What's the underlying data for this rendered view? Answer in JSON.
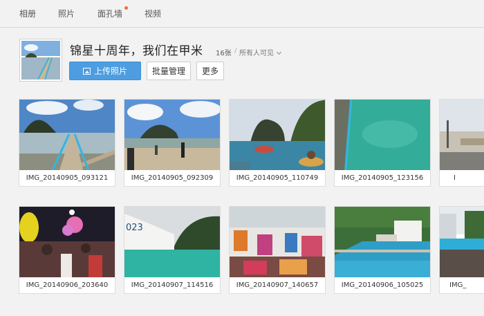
{
  "tabs": [
    {
      "label": "相册"
    },
    {
      "label": "照片"
    },
    {
      "label": "面孔墙",
      "has_dot": true
    },
    {
      "label": "视频"
    }
  ],
  "album": {
    "title": "锦星十周年，我们在甲米",
    "count": "16张",
    "separator": "/",
    "visibility": "所有人可见"
  },
  "buttons": {
    "upload": "上传照片",
    "manage": "批量管理",
    "more": "更多"
  },
  "photos_row1": [
    {
      "name": "IMG_20140905_093121"
    },
    {
      "name": "IMG_20140905_092309"
    },
    {
      "name": "IMG_20140905_110749"
    },
    {
      "name": "IMG_20140905_123156"
    },
    {
      "name": "I"
    }
  ],
  "photos_row2": [
    {
      "name": "IMG_20140906_203640"
    },
    {
      "name": "IMG_20140907_114516"
    },
    {
      "name": "IMG_20140907_140657"
    },
    {
      "name": "IMG_20140906_105025"
    },
    {
      "name": "IMG_"
    }
  ],
  "colors": {
    "accent": "#4d9de0",
    "notification_dot": "#f06b3c",
    "background": "#f2f2f2"
  }
}
